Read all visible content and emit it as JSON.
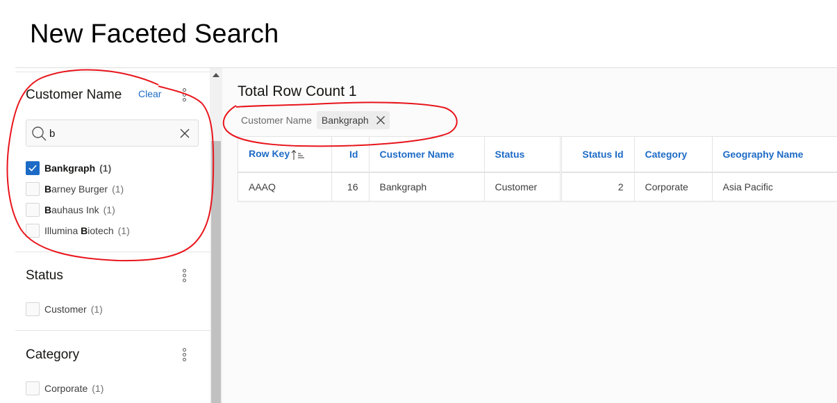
{
  "page": {
    "title": "New Faceted Search"
  },
  "facets": {
    "customer_name": {
      "title": "Customer Name",
      "clear_label": "Clear",
      "search": {
        "value": "b",
        "placeholder": ""
      },
      "options": [
        {
          "label": "Bankgraph",
          "match_prefix": "B",
          "match_rest": "ankgraph",
          "pre": "",
          "count": "(1)",
          "checked": true
        },
        {
          "label": "Barney Burger",
          "pre": "",
          "match": "B",
          "post": "arney Burger",
          "count": "(1)",
          "checked": false
        },
        {
          "label": "Bauhaus Ink",
          "pre": "",
          "match": "B",
          "post": "auhaus Ink",
          "count": "(1)",
          "checked": false
        },
        {
          "label": "Illumina Biotech",
          "pre": "Illumina ",
          "match": "B",
          "post": "iotech",
          "count": "(1)",
          "checked": false
        }
      ]
    },
    "status": {
      "title": "Status",
      "options": [
        {
          "label": "Customer",
          "count": "(1)",
          "checked": false
        }
      ]
    },
    "category": {
      "title": "Category",
      "options": [
        {
          "label": "Corporate",
          "count": "(1)",
          "checked": false
        }
      ]
    }
  },
  "results": {
    "row_count_label": "Total Row Count 1",
    "filter_chips": [
      {
        "facet": "Customer Name",
        "value": "Bankgraph"
      }
    ],
    "columns": [
      "Row Key",
      "Id",
      "Customer Name",
      "Status",
      "Status Id",
      "Category",
      "Geography Name"
    ],
    "sort": {
      "column": "Row Key",
      "direction": "ascending"
    },
    "rows": [
      [
        "AAAQ",
        "16",
        "Bankgraph",
        "Customer",
        "2",
        "Corporate",
        "Asia Pacific"
      ]
    ]
  },
  "colors": {
    "accent": "#1d6bc6",
    "annotation": "#e8141b"
  }
}
